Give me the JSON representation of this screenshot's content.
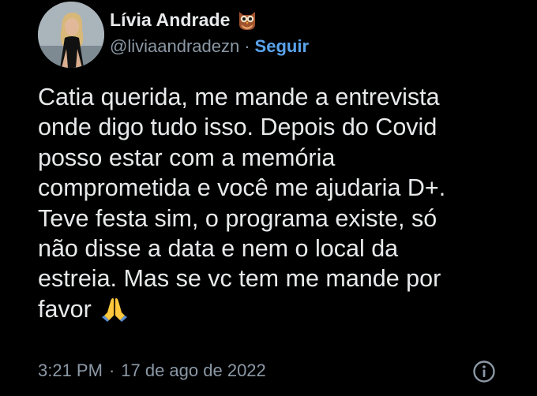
{
  "author": {
    "display_name": "Lívia Andrade",
    "name_badge_icon": "owl-icon",
    "handle": "@liviaandradezn",
    "separator": "·",
    "follow_label": "Seguir"
  },
  "tweet": {
    "text": "Catia querida, me mande a entrevista\nonde digo tudo isso. Depois do Covid\nposso estar com a memória\ncomprometida e você me ajudaria D+.\nTeve festa sim, o programa existe, só\nnão disse a data e nem o local da\nestreia. Mas se vc tem me mande por\nfavor",
    "trailing_emoji_icon": "folded-hands-icon"
  },
  "meta": {
    "time": "3:21 PM",
    "separator": "·",
    "date": "17 de ago de 2022",
    "info_icon": "info-icon"
  },
  "colors": {
    "background": "#000000",
    "text": "#e7e9ea",
    "secondary": "#8b98a5",
    "link": "#5aa3ec"
  }
}
